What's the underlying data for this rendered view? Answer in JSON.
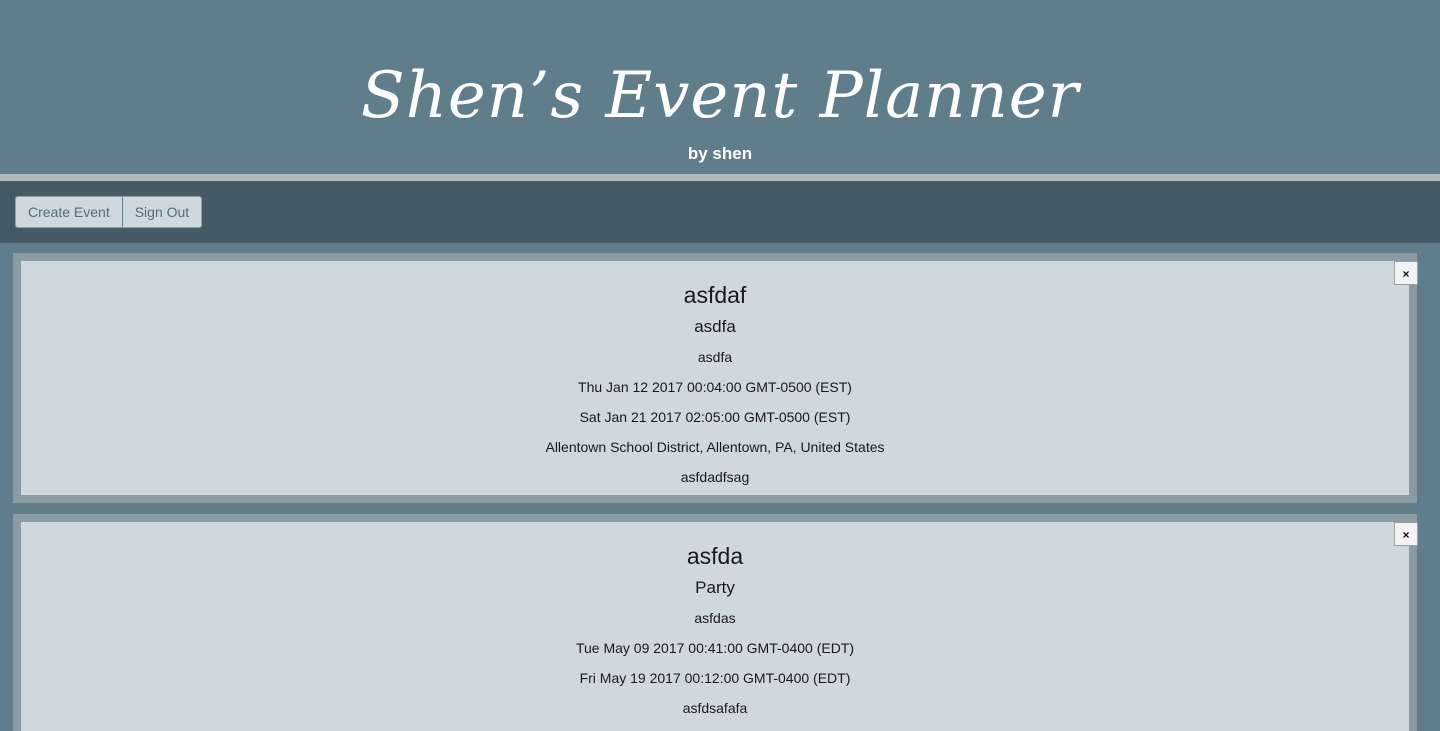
{
  "header": {
    "title": "Shen’s Event Planner",
    "subtitle": "by shen"
  },
  "toolbar": {
    "create_label": "Create Event",
    "signout_label": "Sign Out"
  },
  "events": [
    {
      "close_label": "×",
      "title": "asfdaf",
      "type": "asdfa",
      "host": "asdfa",
      "start": "Thu Jan 12 2017 00:04:00 GMT-0500 (EST)",
      "end": "Sat Jan 21 2017 02:05:00 GMT-0500 (EST)",
      "location": "Allentown School District, Allentown, PA, United States",
      "message": "asfdadfsag"
    },
    {
      "close_label": "×",
      "title": "asfda",
      "type": "Party",
      "host": "asfdas",
      "start": "Tue May 09 2017 00:41:00 GMT-0400 (EDT)",
      "end": "Fri May 19 2017 00:12:00 GMT-0400 (EDT)",
      "location": "asfdsafafa"
    }
  ]
}
